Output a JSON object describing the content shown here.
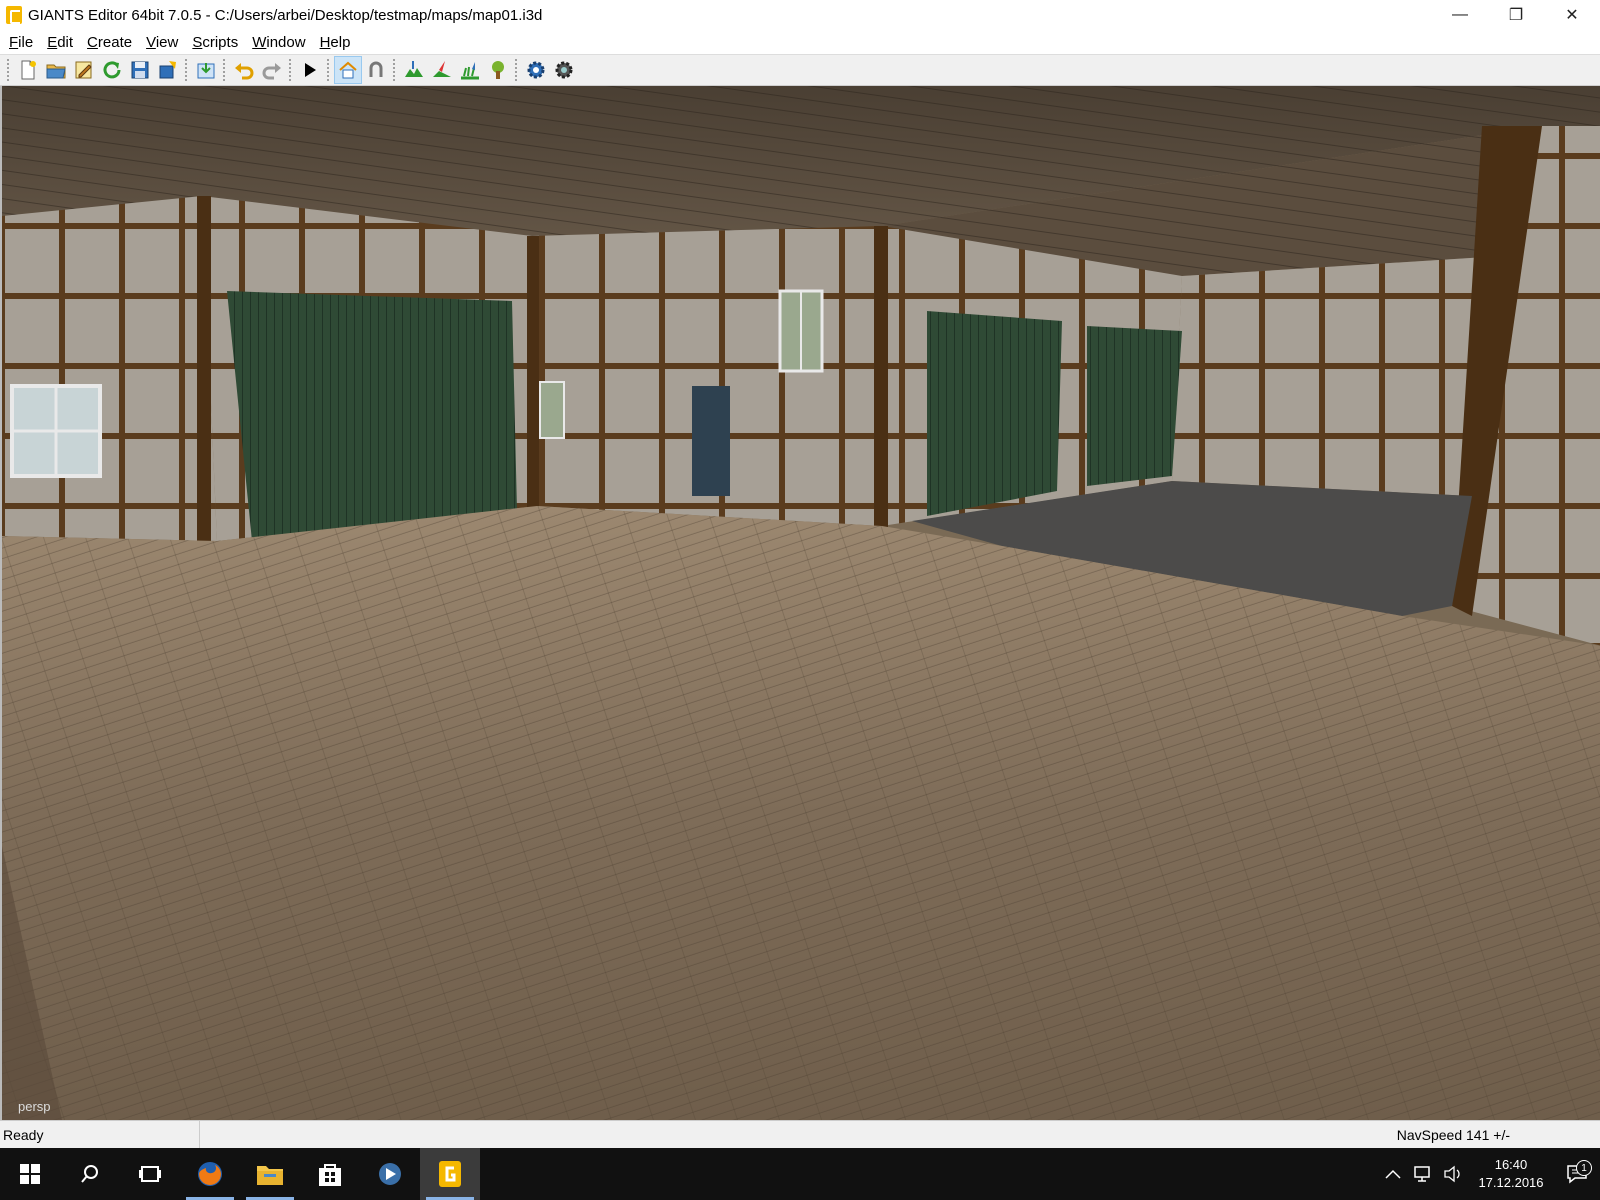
{
  "window": {
    "title": "GIANTS Editor 64bit 7.0.5 - C:/Users/arbei/Desktop/testmap/maps/map01.i3d",
    "controls": {
      "minimize": "—",
      "restore": "❐",
      "close": "✕"
    }
  },
  "menu": [
    {
      "label": "File"
    },
    {
      "label": "Edit"
    },
    {
      "label": "Create"
    },
    {
      "label": "View"
    },
    {
      "label": "Scripts"
    },
    {
      "label": "Window"
    },
    {
      "label": "Help"
    }
  ],
  "toolbar": {
    "buttons": [
      {
        "icon": "new-file-icon"
      },
      {
        "icon": "open-folder-icon"
      },
      {
        "icon": "edit-icon"
      },
      {
        "icon": "refresh-icon"
      },
      {
        "icon": "save-icon"
      },
      {
        "icon": "export-icon"
      },
      {
        "icon": "import-icon"
      },
      {
        "icon": "undo-icon"
      },
      {
        "icon": "redo-icon"
      },
      {
        "icon": "play-icon"
      },
      {
        "icon": "home-icon",
        "active": true
      },
      {
        "icon": "magnet-icon"
      },
      {
        "icon": "terrain-sculpt-icon"
      },
      {
        "icon": "terrain-paint-icon"
      },
      {
        "icon": "foliage-paint-icon"
      },
      {
        "icon": "tree-icon"
      },
      {
        "icon": "settings-gear-icon"
      },
      {
        "icon": "settings-gear-2-icon"
      }
    ]
  },
  "viewport": {
    "camera_label": "persp"
  },
  "status": {
    "left": "Ready",
    "right": "NavSpeed 141 +/-"
  },
  "taskbar": {
    "apps": [
      {
        "icon": "windows-start-icon"
      },
      {
        "icon": "search-icon"
      },
      {
        "icon": "task-view-icon"
      },
      {
        "icon": "firefox-icon",
        "running": true
      },
      {
        "icon": "file-explorer-icon",
        "running": true
      },
      {
        "icon": "store-icon"
      },
      {
        "icon": "media-player-icon"
      },
      {
        "icon": "giants-editor-icon",
        "running": true,
        "active": true
      }
    ],
    "clock": {
      "time": "16:40",
      "date": "17.12.2016"
    },
    "notification_count": "1"
  },
  "colors": {
    "accent": "#f5b800",
    "taskbar": "#111111",
    "toolbar": "#f0f0f0"
  }
}
